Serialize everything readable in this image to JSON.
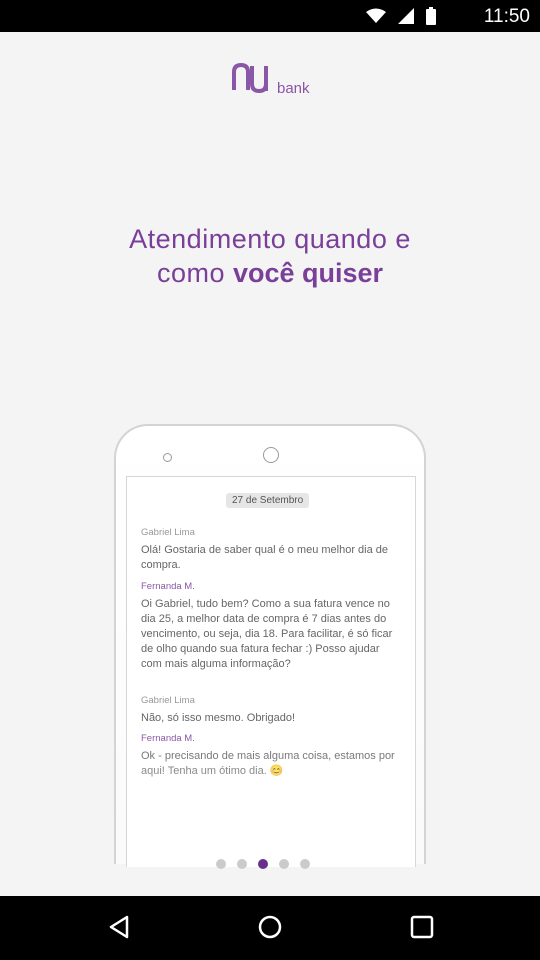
{
  "status_bar": {
    "time": "11:50",
    "icons": [
      "wifi-icon",
      "signal-icon",
      "battery-icon"
    ]
  },
  "logo": {
    "mark": "nu",
    "text": "bank"
  },
  "headline": {
    "line1": "Atendimento quando e",
    "line2_prefix": "como",
    "line2_emphasis": "você quiser"
  },
  "chat": {
    "date": "27 de Setembro",
    "messages": [
      {
        "author": "Gabriel Lima",
        "text": "Olá! Gostaria de saber qual é o meu melhor dia de compra."
      },
      {
        "author": "Fernanda M.",
        "text": "Oi Gabriel, tudo bem? Como a sua fatura vence no dia 25, a melhor data de compra é 7 dias antes do vencimento, ou seja, dia 18. Para facilitar, é só ficar de olho quando sua fatura fechar :) Posso ajudar com mais alguma informação?"
      },
      {
        "author": "Gabriel Lima",
        "text": "Não, só isso mesmo. Obrigado!"
      },
      {
        "author": "Fernanda M.",
        "text": "Ok - precisando de mais alguma coisa, estamos por aqui! Tenha um ótimo dia. 😊"
      }
    ]
  },
  "pager": {
    "count": 5,
    "active_index": 2
  },
  "colors": {
    "brand": "#7a3f99",
    "active_dot": "#6a2e8c",
    "inactive_dot": "#cbcbcb"
  },
  "nav_bar": {
    "icons": [
      "back-icon",
      "home-icon",
      "recents-icon"
    ]
  }
}
